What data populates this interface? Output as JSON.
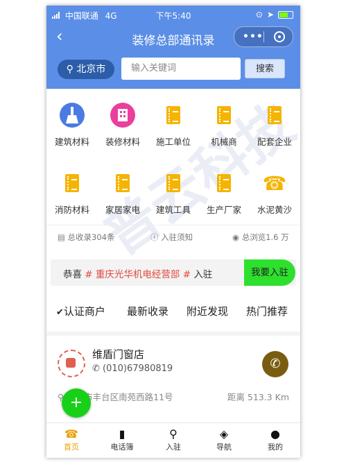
{
  "status_bar": {
    "carrier": "中国联通",
    "network": "4G",
    "time": "下午5:40"
  },
  "nav": {
    "back_glyph": "‹",
    "title": "装修总部通讯录",
    "more_glyph": "•••"
  },
  "search": {
    "city": "北京市",
    "placeholder": "输入关键词",
    "button": "搜索"
  },
  "categories": [
    {
      "label": "建筑材料",
      "icon": "broom-icon"
    },
    {
      "label": "装修材料",
      "icon": "building-icon"
    },
    {
      "label": "施工单位",
      "icon": "book-icon"
    },
    {
      "label": "机械商",
      "icon": "book-icon"
    },
    {
      "label": "配套企业",
      "icon": "book-icon"
    },
    {
      "label": "消防材料",
      "icon": "book-icon"
    },
    {
      "label": "家居家电",
      "icon": "book-icon"
    },
    {
      "label": "建筑工具",
      "icon": "book-icon"
    },
    {
      "label": "生产厂家",
      "icon": "book-icon"
    },
    {
      "label": "水泥黄沙",
      "icon": "phone-icon"
    }
  ],
  "stats": {
    "total": "总收录304条",
    "notice": "入驻须知",
    "views": "总浏览1.6 万"
  },
  "announcement": {
    "prefix": "恭喜",
    "hash1": "#",
    "company": "重庆光华机电经营部",
    "hash2": "#",
    "suffix": "入驻",
    "button": "我要入驻"
  },
  "tabs": [
    "认证商户",
    "最新收录",
    "附近发现",
    "热门推荐"
  ],
  "listing": {
    "name": "维盾门窗店",
    "phone": "(010)67980819",
    "address": "北京市丰台区南苑西路11号",
    "distance": "距离 513.3 Km"
  },
  "fab": "+",
  "tabbar": [
    {
      "label": "首页",
      "icon": "phone-icon",
      "active": true
    },
    {
      "label": "电话簿",
      "icon": "book-icon",
      "active": false
    },
    {
      "label": "入驻",
      "icon": "pin-icon",
      "active": false
    },
    {
      "label": "导航",
      "icon": "compass-icon",
      "active": false
    },
    {
      "label": "我的",
      "icon": "user-icon",
      "active": false
    }
  ],
  "watermark": "普云科技",
  "colors": {
    "header": "#5b8ee6",
    "accent": "#e8a000",
    "join_button": "#2ee02e",
    "highlight": "#e0483e"
  }
}
